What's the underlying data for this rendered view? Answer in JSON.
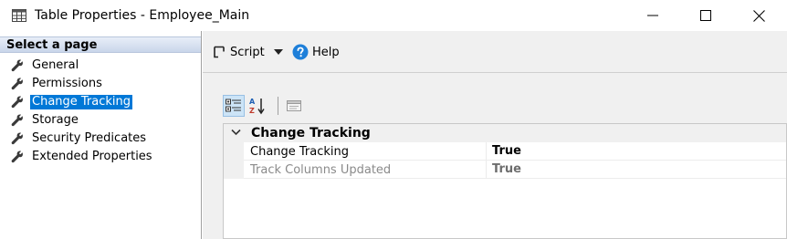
{
  "window": {
    "title": "Table Properties - Employee_Main",
    "icon": "table-grid-icon"
  },
  "left_panel": {
    "header": "Select a page",
    "pages": [
      {
        "label": "General",
        "icon": "wrench-icon",
        "selected": false
      },
      {
        "label": "Permissions",
        "icon": "wrench-icon",
        "selected": false
      },
      {
        "label": "Change Tracking",
        "icon": "wrench-icon",
        "selected": true
      },
      {
        "label": "Storage",
        "icon": "wrench-icon",
        "selected": false
      },
      {
        "label": "Security Predicates",
        "icon": "wrench-icon",
        "selected": false
      },
      {
        "label": "Extended Properties",
        "icon": "wrench-icon",
        "selected": false
      }
    ]
  },
  "toolbar": {
    "script_label": "Script",
    "help_label": "Help"
  },
  "property_grid": {
    "category": "Change Tracking",
    "rows": [
      {
        "name": "Change Tracking",
        "value": "True",
        "enabled": true
      },
      {
        "name": "Track Columns Updated",
        "value": "True",
        "enabled": false
      }
    ]
  },
  "colors": {
    "selection": "#0078d7",
    "help_icon": "#1e7fd9",
    "panel_bg": "#f0f0f0"
  }
}
